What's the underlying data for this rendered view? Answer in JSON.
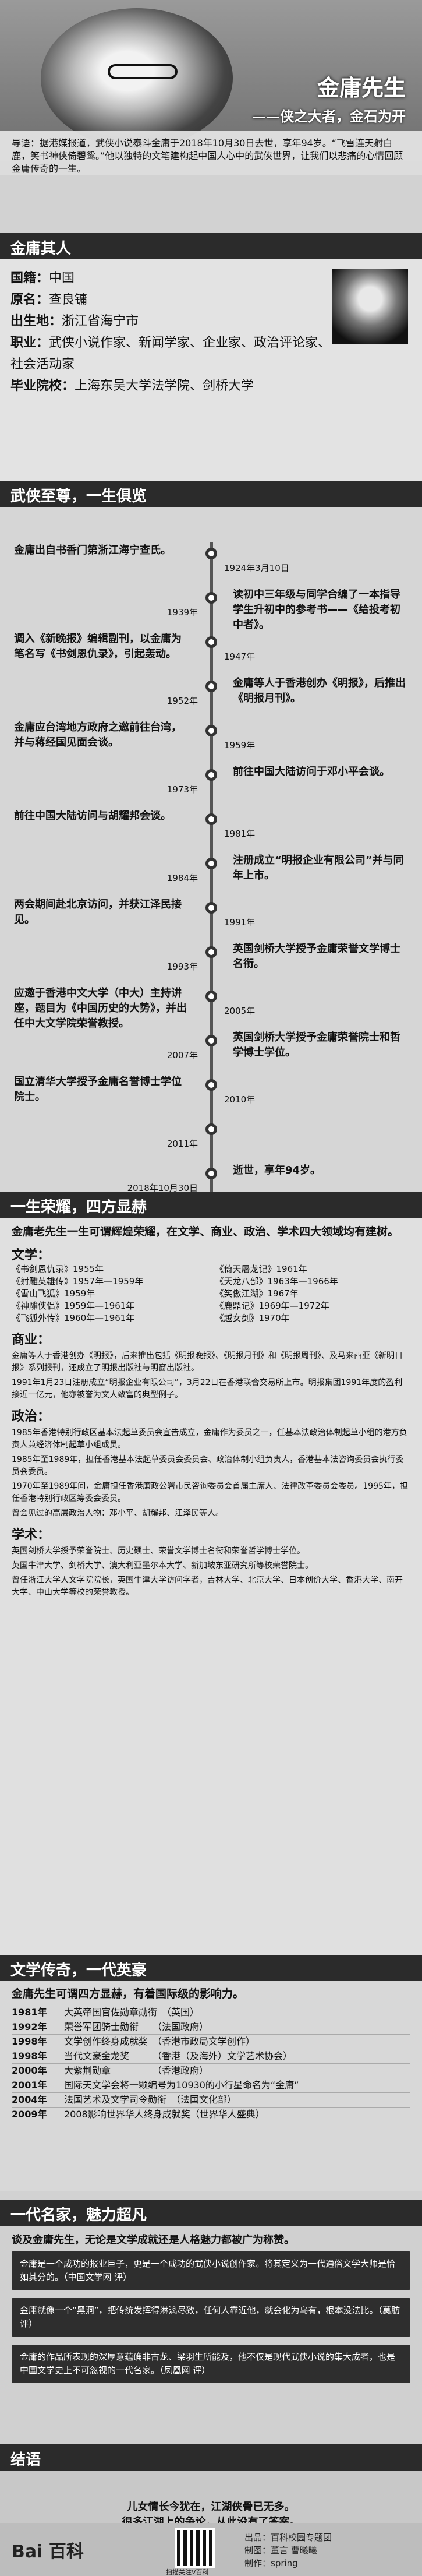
{
  "hero": {
    "title": "金庸先生",
    "subtitle": "——侠之大者，金石为开",
    "intro": "导语：据港媒报道，武侠小说泰斗金庸于2018年10月30日去世，享年94岁。“飞雪连天射白鹿，笑书神侠倚碧鸳。”他以独特的文笔建构起中国人心中的武侠世界，让我们以悲痛的心情回顾金庸传奇的一生。"
  },
  "person": {
    "section_title": "金庸其人",
    "rows": [
      {
        "k": "国籍：",
        "v": "中国"
      },
      {
        "k": "原名：",
        "v": "查良镛"
      },
      {
        "k": "出生地：",
        "v": "浙江省海宁市"
      },
      {
        "k": "职业：",
        "v": "武侠小说作家、新闻学家、企业家、政治评论家、社会活动家"
      },
      {
        "k": "毕业院校：",
        "v": "上海东吴大学法学院、剑桥大学"
      }
    ]
  },
  "timeline": {
    "section_title": "武侠至尊，一生俱览",
    "events": [
      {
        "year": "1924年3月10日",
        "text": "金庸出自书香门第浙江海宁查氏。",
        "side": "left"
      },
      {
        "year": "1939年",
        "text": "读初中三年级与同学合编了一本指导学生升初中的参考书——《给投考初中者》。",
        "side": "right"
      },
      {
        "year": "1947年",
        "text": "调入《新晚报》编辑副刊，以金庸为笔名写《书剑恩仇录》，引起轰动。",
        "side": "left"
      },
      {
        "year": "1952年",
        "text": "金庸等人于香港创办《明报》，后推出《明报月刊》。",
        "side": "right"
      },
      {
        "year": "1959年",
        "text": "金庸应台湾地方政府之邀前往台湾，并与蒋经国见面会谈。",
        "side": "left"
      },
      {
        "year": "1973年",
        "text": "前往中国大陆访问于邓小平会谈。",
        "side": "right"
      },
      {
        "year": "1981年",
        "text": "前往中国大陆访问与胡耀邦会谈。",
        "side": "left"
      },
      {
        "year": "1984年",
        "text": "注册成立“明报企业有限公司”并与同年上市。",
        "side": "right"
      },
      {
        "year": "1991年",
        "text": "两会期间赴北京访问，并获江泽民接见。",
        "side": "left"
      },
      {
        "year": "1993年",
        "text": "英国剑桥大学授予金庸荣誉文学博士名衔。",
        "side": "right"
      },
      {
        "year": "2005年",
        "text": "应邀于香港中文大学（中大）主持讲座，题目为《中国历史的大势》，并出任中大文学院荣誉教授。",
        "side": "left"
      },
      {
        "year": "2007年",
        "text": "英国剑桥大学授予金庸荣誉院士和哲学博士学位。",
        "side": "right"
      },
      {
        "year": "2010年",
        "text": "国立清华大学授予金庸名誉博士学位院士。",
        "side": "left"
      },
      {
        "year": "2011年",
        "text": "",
        "side": "right"
      },
      {
        "year": "2018年10月30日",
        "text": "逝世，享年94岁。",
        "side": "right"
      }
    ]
  },
  "honors": {
    "section_title": "一生荣耀，四方显赫",
    "intro": "金庸老先生一生可谓辉煌荣耀，在文学、商业、政治、学术四大领域均有建树。",
    "literature_head": "文学：",
    "works": [
      "《书剑恩仇录》1955年",
      "《倚天屠龙记》1961年",
      "《射雕英雄传》1957年—1959年",
      "《天龙八部》1963年—1966年",
      "《雪山飞狐》1959年",
      "《笑傲江湖》1967年",
      "《神雕侠侣》1959年—1961年",
      "《鹿鼎记》1969年—1972年",
      "《飞狐外传》1960年—1961年",
      "《越女剑》1970年"
    ],
    "business_head": "商业：",
    "business": [
      "金庸等人于香港创办《明报》，后来推出包括《明报晚报》、《明报月刊》和《明报周刊》、及马来西亚《新明日报》系列报刊，还成立了明报出版社与明窗出版社。",
      "1991年1月23日注册成立“明报企业有限公司”，3月22日在香港联合交易所上市。明报集团1991年度的盈利接近一亿元，他亦被誉为文人致富的典型例子。"
    ],
    "politics_head": "政治：",
    "politics": [
      "1985年香港特别行政区基本法起草委员会宣告成立，金庸作为委员之一，任基本法政治体制起草小组的港方负责人兼经济体制起草小组成员。",
      "1985年至1989年，担任香港基本法起草委员会委员会、政治体制小组负责人，香港基本法咨询委员会执行委员会委员。",
      "1970年至1989年间，金庸担任香港廉政公署市民咨询委员会首届主席人、法律改革委员会委员。1995年，担任香港特别行政区筹委会委员。",
      "曾会见过的高层政治人物：邓小平、胡耀邦、江泽民等人。"
    ],
    "academic_head": "学术：",
    "academic": [
      "英国剑桥大学授予荣誉院士、历史硕士、荣誉文学博士名衔和荣誉哲学博士学位。",
      "英国牛津大学、剑桥大学、澳大利亚墨尔本大学、新加坡东亚研究所等校荣誉院士。",
      "曾任浙江大学人文学院院长，英国牛津大学访问学者，吉林大学、北京大学、日本创价大学、香港大学、南开大学、中山大学等校的荣誉教授。"
    ]
  },
  "legend": {
    "section_title": "文学传奇，一代英豪",
    "intro": "金庸先生可谓四方显赫，有着国际级的影响力。",
    "rows": [
      {
        "year": "1981年",
        "text": "大英帝国官佐勋章勋衔　（英国）"
      },
      {
        "year": "1992年",
        "text": "荣誉军团骑士勋衔　　（法国政府）"
      },
      {
        "year": "1998年",
        "text": "文学创作终身成就奖　（香港市政局文学创作）"
      },
      {
        "year": "1998年",
        "text": "当代文豪金龙奖　　　（香港（及海外）文学艺术协会）"
      },
      {
        "year": "2000年",
        "text": "大紫荆勋章　　　　　（香港政府）"
      },
      {
        "year": "2001年",
        "text": "国际天文学会将一颗编号为10930的小行星命名为“金庸”"
      },
      {
        "year": "2004年",
        "text": "法国艺术及文学司令勋衔　（法国文化部）"
      },
      {
        "year": "2009年",
        "text": "2008影响世界华人终身成就奖（世界华人盛典）"
      }
    ]
  },
  "quotes": {
    "section_title": "一代名家，魅力超凡",
    "intro": "谈及金庸先生，无论是文学成就还是人格魅力都被广为称赞。",
    "items": [
      "金庸是一个成功的报业巨子，更是一个成功的武侠小说创作家。将其定义为一代通俗文学大师是恰如其分的。（中国文学网 评）",
      "金庸就像一个“黑洞”，把传统发挥得淋漓尽致，任何人靠近他，就会化为乌有，根本没法比。（莫肪 评）",
      "金庸的作品所表现的深厚意蕴确非古龙、梁羽生所能及，他不仅是现代武侠小说的集大成者，也是中国文学史上不可忽视的一代名家。（凤凰网 评）"
    ]
  },
  "ending": {
    "section_title": "结语",
    "lines": [
      "儿女情长今犹在，江湖侠骨已无多。",
      "很多江湖上的争论，从此没有了答案。"
    ]
  },
  "footer": {
    "logo": "Bai 百科",
    "qr_caption": "扫描关注V百科",
    "credits": [
      "出品：百科校园专题团",
      "制图：董言 曹曦曦",
      "制作：spring"
    ]
  }
}
